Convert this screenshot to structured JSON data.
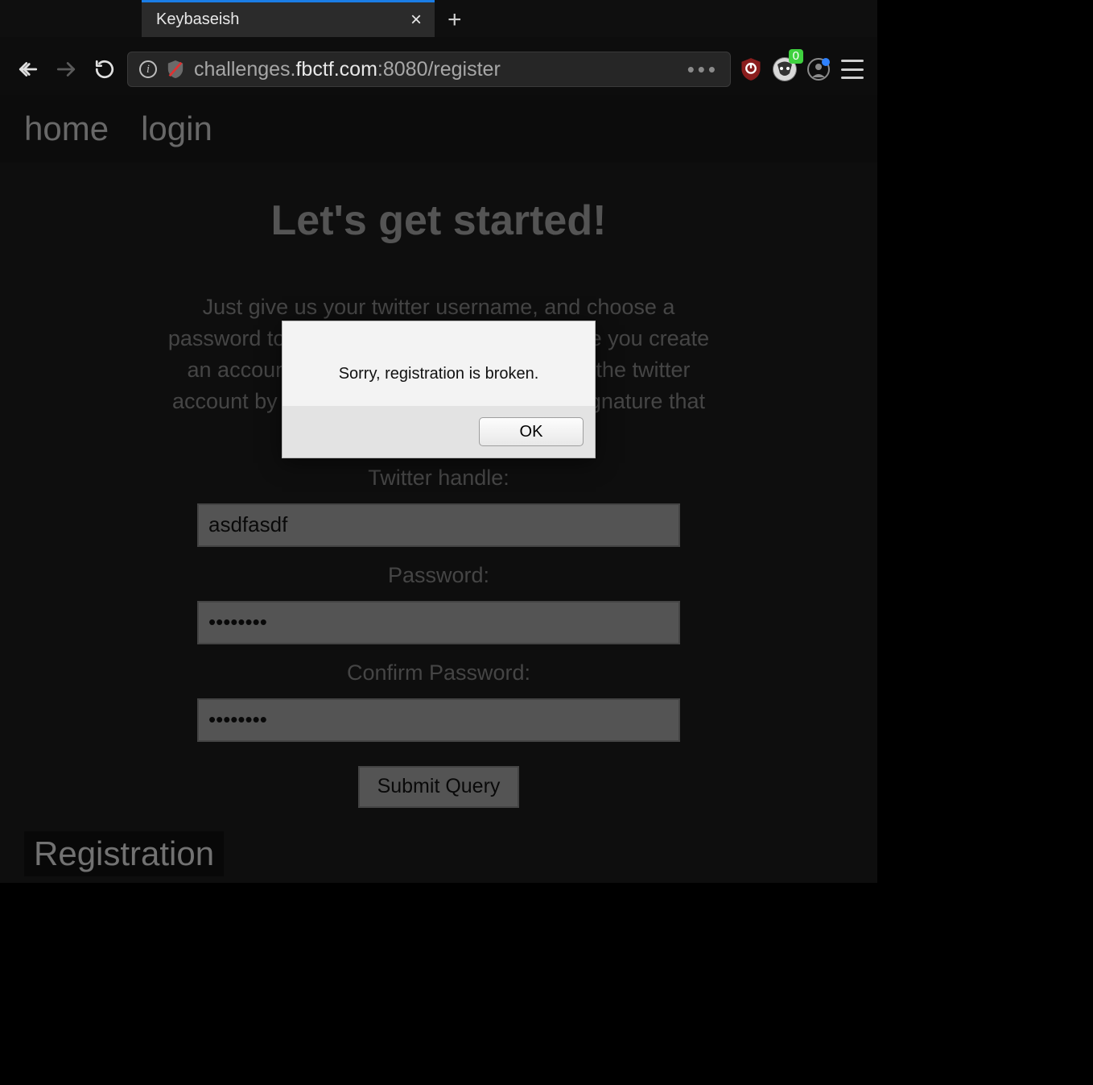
{
  "window": {
    "tab_title": "Keybaseish",
    "new_tab_label": "+"
  },
  "nav": {
    "url_display_pre": "challenges.",
    "url_display_host": "fbctf.com",
    "url_display_post": ":8080/register"
  },
  "toolbar": {
    "badger_badge": "0"
  },
  "site_nav": {
    "home": "home",
    "login": "login"
  },
  "page": {
    "headline": "Let's get started!",
    "intro": "Just give us your twitter username, and choose a password to create an account with us. Once you create an account, you'll verify your ownership of the twitter account by posting an unforgeable digital signature that you own the account.",
    "twitter_label": "Twitter handle:",
    "twitter_value": "asdfasdf",
    "password_label": "Password:",
    "password_value": "••••••••",
    "confirm_label": "Confirm Password:",
    "confirm_value": "••••••••",
    "submit_label": "Submit Query",
    "footer_title": "Registration"
  },
  "modal": {
    "message": "Sorry, registration is broken.",
    "ok_label": "OK"
  }
}
